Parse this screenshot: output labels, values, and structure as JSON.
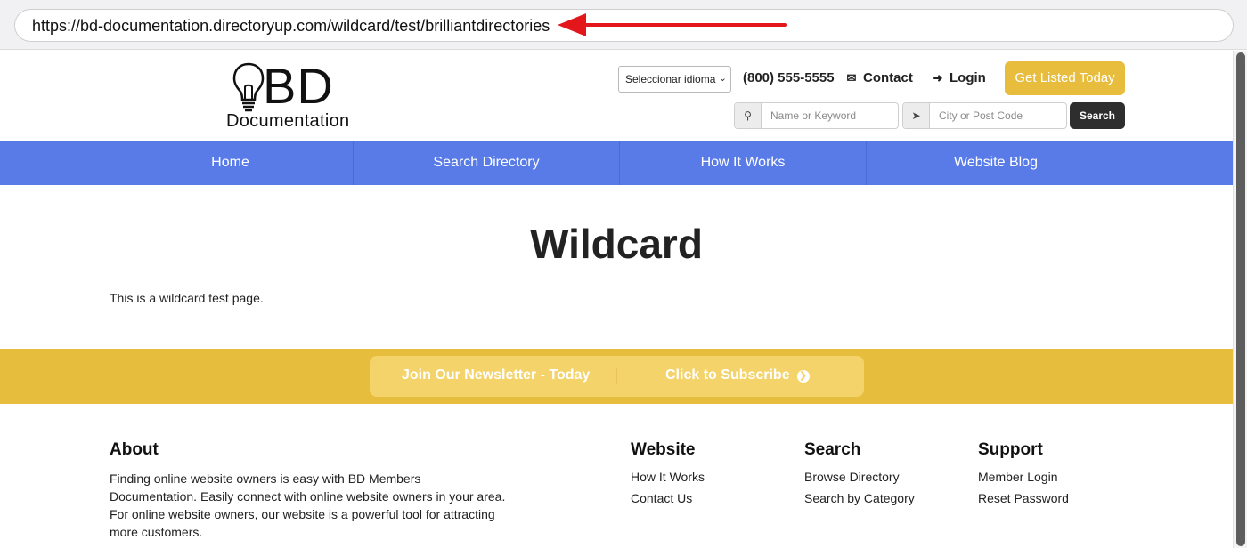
{
  "browser": {
    "url": "https://bd-documentation.directoryup.com/wildcard/test/brilliantdirectories",
    "annotation_color": "#e3161b"
  },
  "header": {
    "logo_big": "BD",
    "logo_small": "Documentation",
    "language_select": "Seleccionar idioma",
    "phone": "(800) 555-5555",
    "contact_label": "Contact",
    "login_label": "Login",
    "cta_label": "Get Listed Today",
    "keyword_placeholder": "Name or Keyword",
    "location_placeholder": "City or Post Code",
    "search_label": "Search"
  },
  "nav": {
    "items": [
      "Home",
      "Search Directory",
      "How It Works",
      "Website Blog"
    ],
    "color": "#587be8"
  },
  "main": {
    "title": "Wildcard",
    "body": "This is a wildcard test page."
  },
  "newsletter": {
    "left": "Join Our Newsletter - Today",
    "right": "Click to Subscribe",
    "color": "#e7bd3e"
  },
  "footer": {
    "about_heading": "About",
    "about_text": "Finding online website owners is easy with BD Members Documentation. Easily connect with online website owners in your area. For online website owners, our website is a powerful tool for attracting more customers.",
    "website_heading": "Website",
    "website_links": [
      "How It Works",
      "Contact Us"
    ],
    "search_heading": "Search",
    "search_links": [
      "Browse Directory",
      "Search by Category"
    ],
    "support_heading": "Support",
    "support_links": [
      "Member Login",
      "Reset Password"
    ]
  }
}
